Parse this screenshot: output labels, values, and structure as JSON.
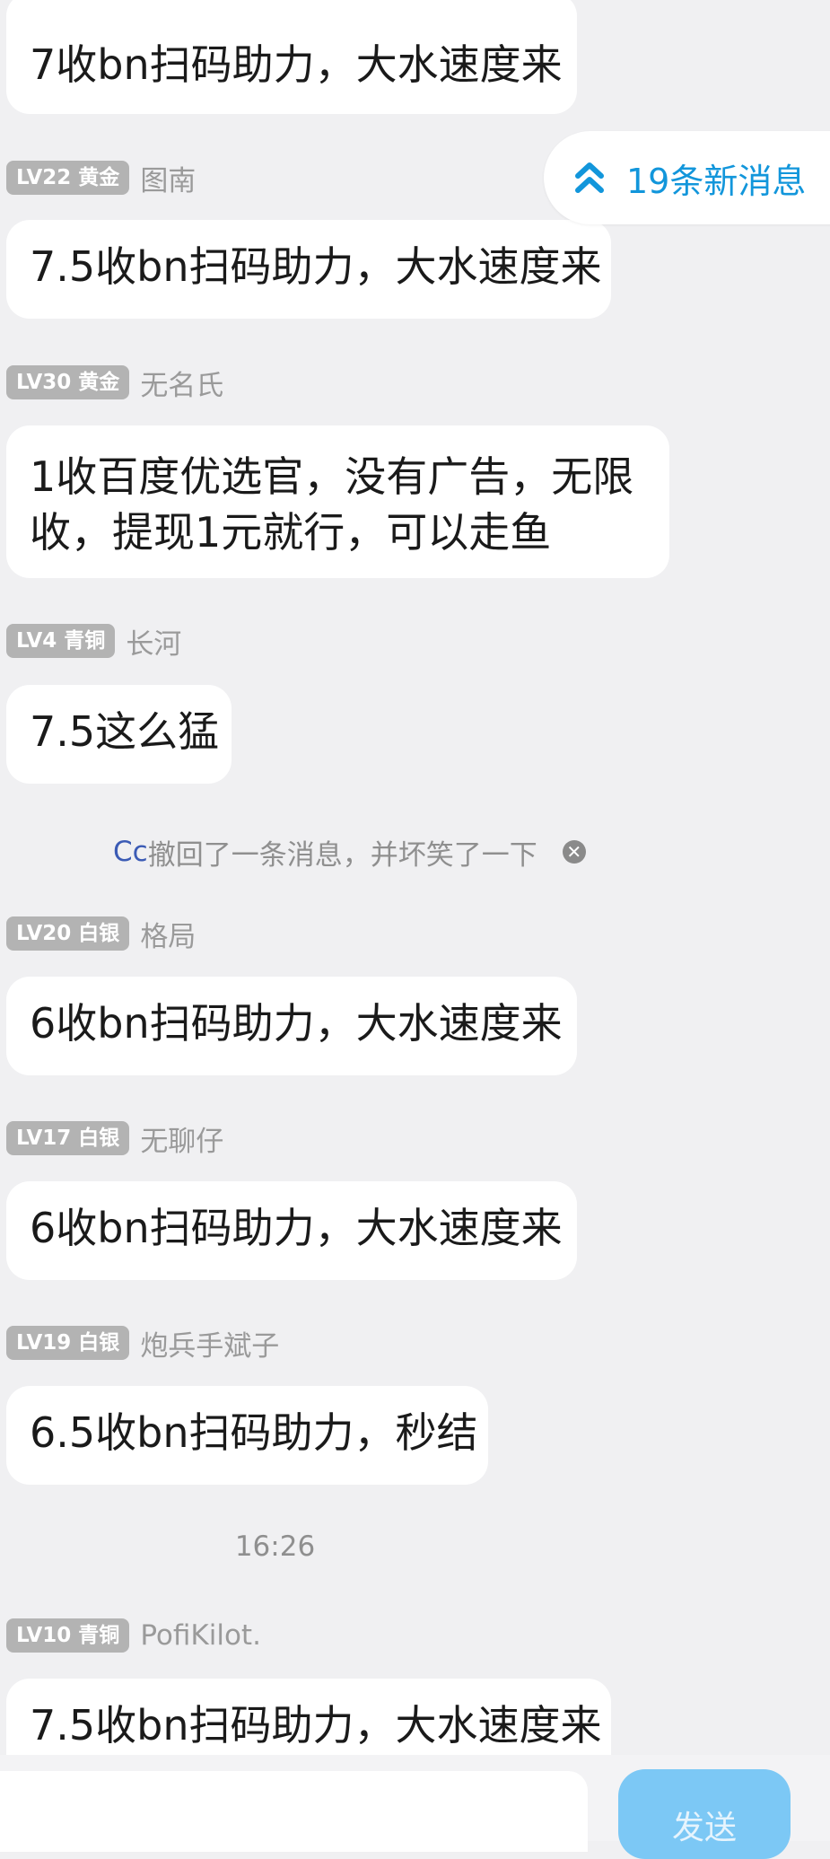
{
  "messages": [
    {
      "badge": "",
      "name": "",
      "text": "7收bn扫码助力，大水速度来"
    },
    {
      "badge": "LV22 黄金",
      "name": "图南",
      "text": "7.5收bn扫码助力，大水速度来"
    },
    {
      "badge": "LV30 黄金",
      "name": "无名氏",
      "text": "1收百度优选官，没有广告，无限收，提现1元就行，可以走鱼"
    },
    {
      "badge": "LV4 青铜",
      "name": "长河",
      "text": "7.5这么猛"
    },
    {
      "badge": "LV20 白银",
      "name": "格局",
      "text": "6收bn扫码助力，大水速度来"
    },
    {
      "badge": "LV17 白银",
      "name": "无聊仔",
      "text": "6收bn扫码助力，大水速度来"
    },
    {
      "badge": "LV19 白银",
      "name": "炮兵手斌子",
      "text": "6.5收bn扫码助力，秒结"
    },
    {
      "badge": "LV10 青铜",
      "name": "PofiKilot.",
      "text": "7.5收bn扫码助力，大水速度来"
    }
  ],
  "recall_notice": {
    "who": "Cc",
    "text": "撤回了一条消息，并坏笑了一下",
    "close_icon": "close-icon"
  },
  "timestamp": "16:26",
  "new_messages": {
    "label": "19条新消息",
    "icon": "double-chevron-up-icon",
    "color": "#1296db"
  },
  "composer": {
    "send_label": "发送",
    "placeholder": "",
    "value": ""
  }
}
